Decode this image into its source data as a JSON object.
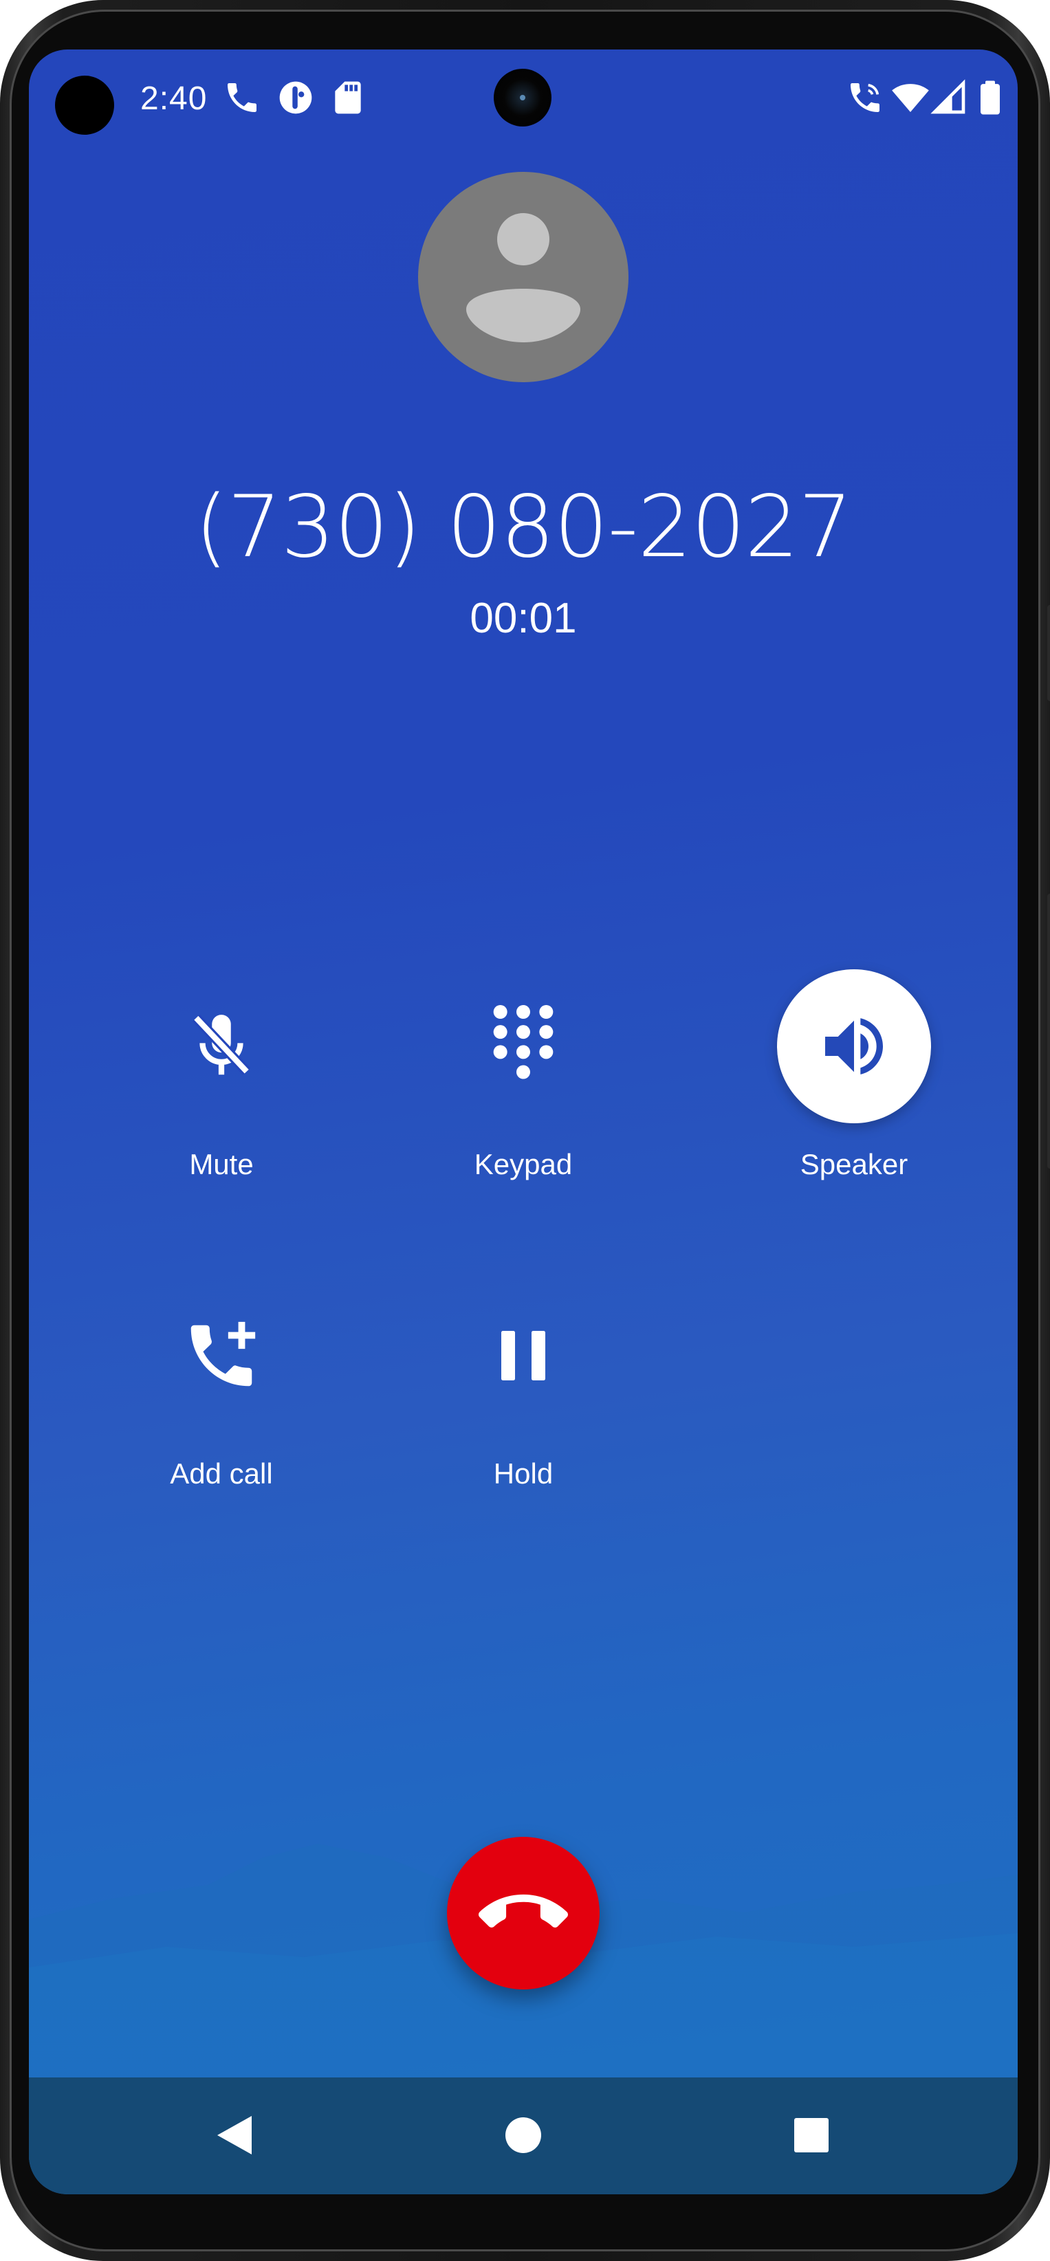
{
  "status_bar": {
    "time": "2:40",
    "left_icons": [
      "phone-call-icon",
      "privacy-indicator-icon",
      "sd-card-icon"
    ],
    "right_icons": [
      "wifi-calling-icon",
      "wifi-icon",
      "cellular-signal-icon",
      "battery-icon"
    ]
  },
  "call": {
    "phone_number": "(730) 080-2027",
    "timer": "00:01",
    "avatar_icon": "person-icon"
  },
  "controls": [
    {
      "label": "Mute",
      "icon": "mic-off-icon",
      "active": false
    },
    {
      "label": "Keypad",
      "icon": "dialpad-icon",
      "active": false
    },
    {
      "label": "Speaker",
      "icon": "speaker-icon",
      "active": true
    },
    {
      "label": "Add call",
      "icon": "add-call-icon",
      "active": false
    },
    {
      "label": "Hold",
      "icon": "pause-icon",
      "active": false
    }
  ],
  "end_call": {
    "icon": "call-end-icon"
  },
  "nav_bar": {
    "back_icon": "back-triangle-icon",
    "home_icon": "home-circle-icon",
    "recents_icon": "recents-square-icon"
  },
  "colors": {
    "background_top": "#2446bb",
    "background_bottom": "#1f70c3",
    "end_call": "#e3000e",
    "nav_bar": "#154a75",
    "avatar": "#7b7b7b",
    "accent_icon": "#2449b8"
  }
}
